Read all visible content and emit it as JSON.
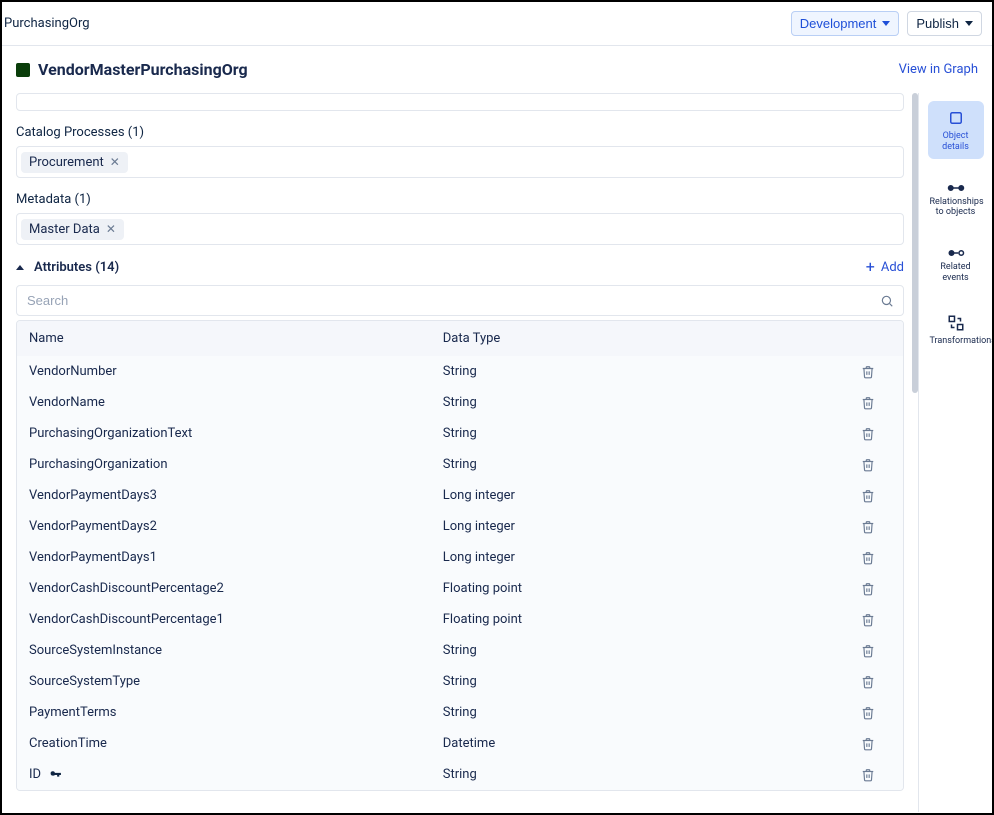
{
  "breadcrumb": "PurchasingOrg",
  "topbar": {
    "env_label": "Development",
    "publish_label": "Publish"
  },
  "title": "VendorMasterPurchasingOrg",
  "view_in_graph": "View in Graph",
  "catalog_processes": {
    "label": "Catalog Processes (1)",
    "items": [
      "Procurement"
    ]
  },
  "metadata": {
    "label": "Metadata (1)",
    "items": [
      "Master Data"
    ]
  },
  "attributes": {
    "header": "Attributes (14)",
    "add_label": "Add",
    "search_placeholder": "Search",
    "columns": {
      "name": "Name",
      "type": "Data Type"
    },
    "rows": [
      {
        "name": "VendorNumber",
        "type": "String",
        "key": false
      },
      {
        "name": "VendorName",
        "type": "String",
        "key": false
      },
      {
        "name": "PurchasingOrganizationText",
        "type": "String",
        "key": false
      },
      {
        "name": "PurchasingOrganization",
        "type": "String",
        "key": false
      },
      {
        "name": "VendorPaymentDays3",
        "type": "Long integer",
        "key": false
      },
      {
        "name": "VendorPaymentDays2",
        "type": "Long integer",
        "key": false
      },
      {
        "name": "VendorPaymentDays1",
        "type": "Long integer",
        "key": false
      },
      {
        "name": "VendorCashDiscountPercentage2",
        "type": "Floating point",
        "key": false
      },
      {
        "name": "VendorCashDiscountPercentage1",
        "type": "Floating point",
        "key": false
      },
      {
        "name": "SourceSystemInstance",
        "type": "String",
        "key": false
      },
      {
        "name": "SourceSystemType",
        "type": "String",
        "key": false
      },
      {
        "name": "PaymentTerms",
        "type": "String",
        "key": false
      },
      {
        "name": "CreationTime",
        "type": "Datetime",
        "key": false
      },
      {
        "name": "ID",
        "type": "String",
        "key": true
      }
    ]
  },
  "right_tabs": {
    "object_details": "Object details",
    "relationships": "Relationships to objects",
    "related_events": "Related events",
    "transformations": "Transformations"
  }
}
